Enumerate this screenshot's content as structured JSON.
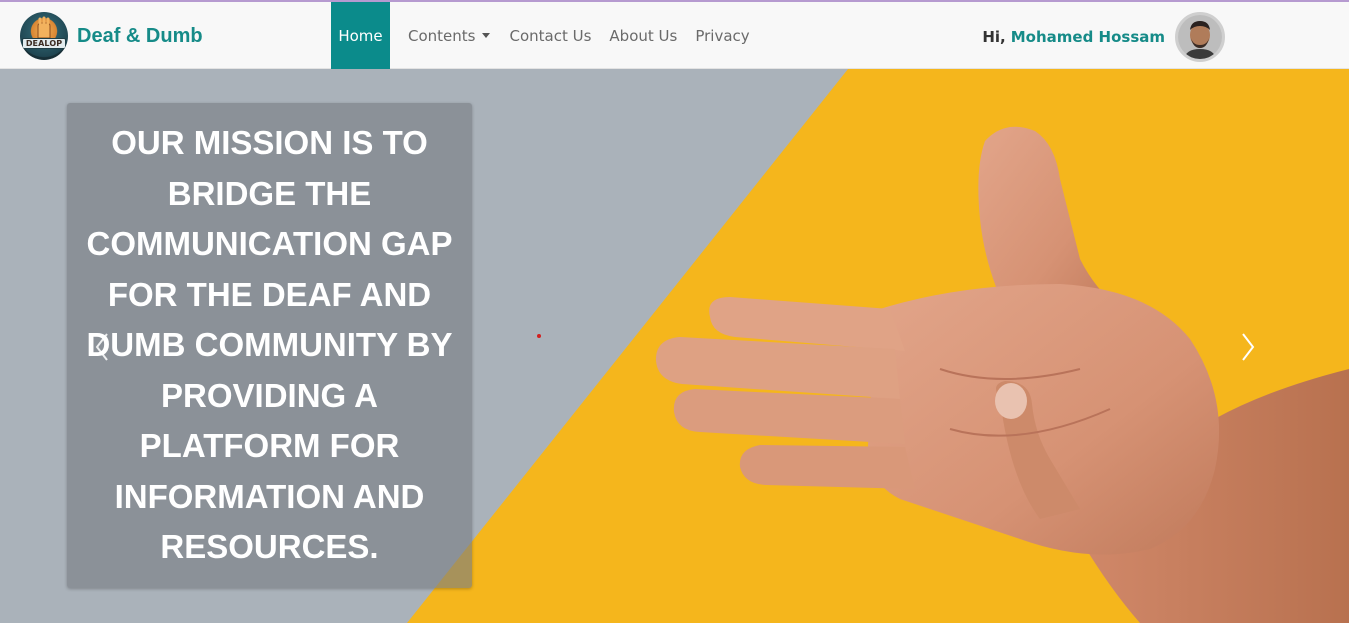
{
  "brand": {
    "logo_text": "DEALOP",
    "name": "Deaf & Dumb"
  },
  "nav": {
    "items": [
      {
        "label": "Home",
        "active": true
      },
      {
        "label": "Contents",
        "dropdown": true
      },
      {
        "label": "Contact Us"
      },
      {
        "label": "About Us"
      },
      {
        "label": "Privacy"
      }
    ]
  },
  "user": {
    "greeting": "Hi,",
    "name": "Mohamed Hossam"
  },
  "hero": {
    "mission": "OUR MISSION IS TO BRIDGE THE COMMUNICATION GAP FOR THE DEAF AND DUMB COMMUNITY BY PROVIDING A PLATFORM FOR INFORMATION AND RESOURCES.",
    "image_description_icons": [
      "hand-sign-image"
    ],
    "prev_icon": "chevron-left-icon",
    "next_icon": "chevron-right-icon"
  },
  "colors": {
    "accent": "#0b8b8b",
    "brand_text": "#168b88",
    "hero_gray": "#aab2ba",
    "hero_yellow": "#f5b61c",
    "nav_border": "#b69ad0"
  }
}
